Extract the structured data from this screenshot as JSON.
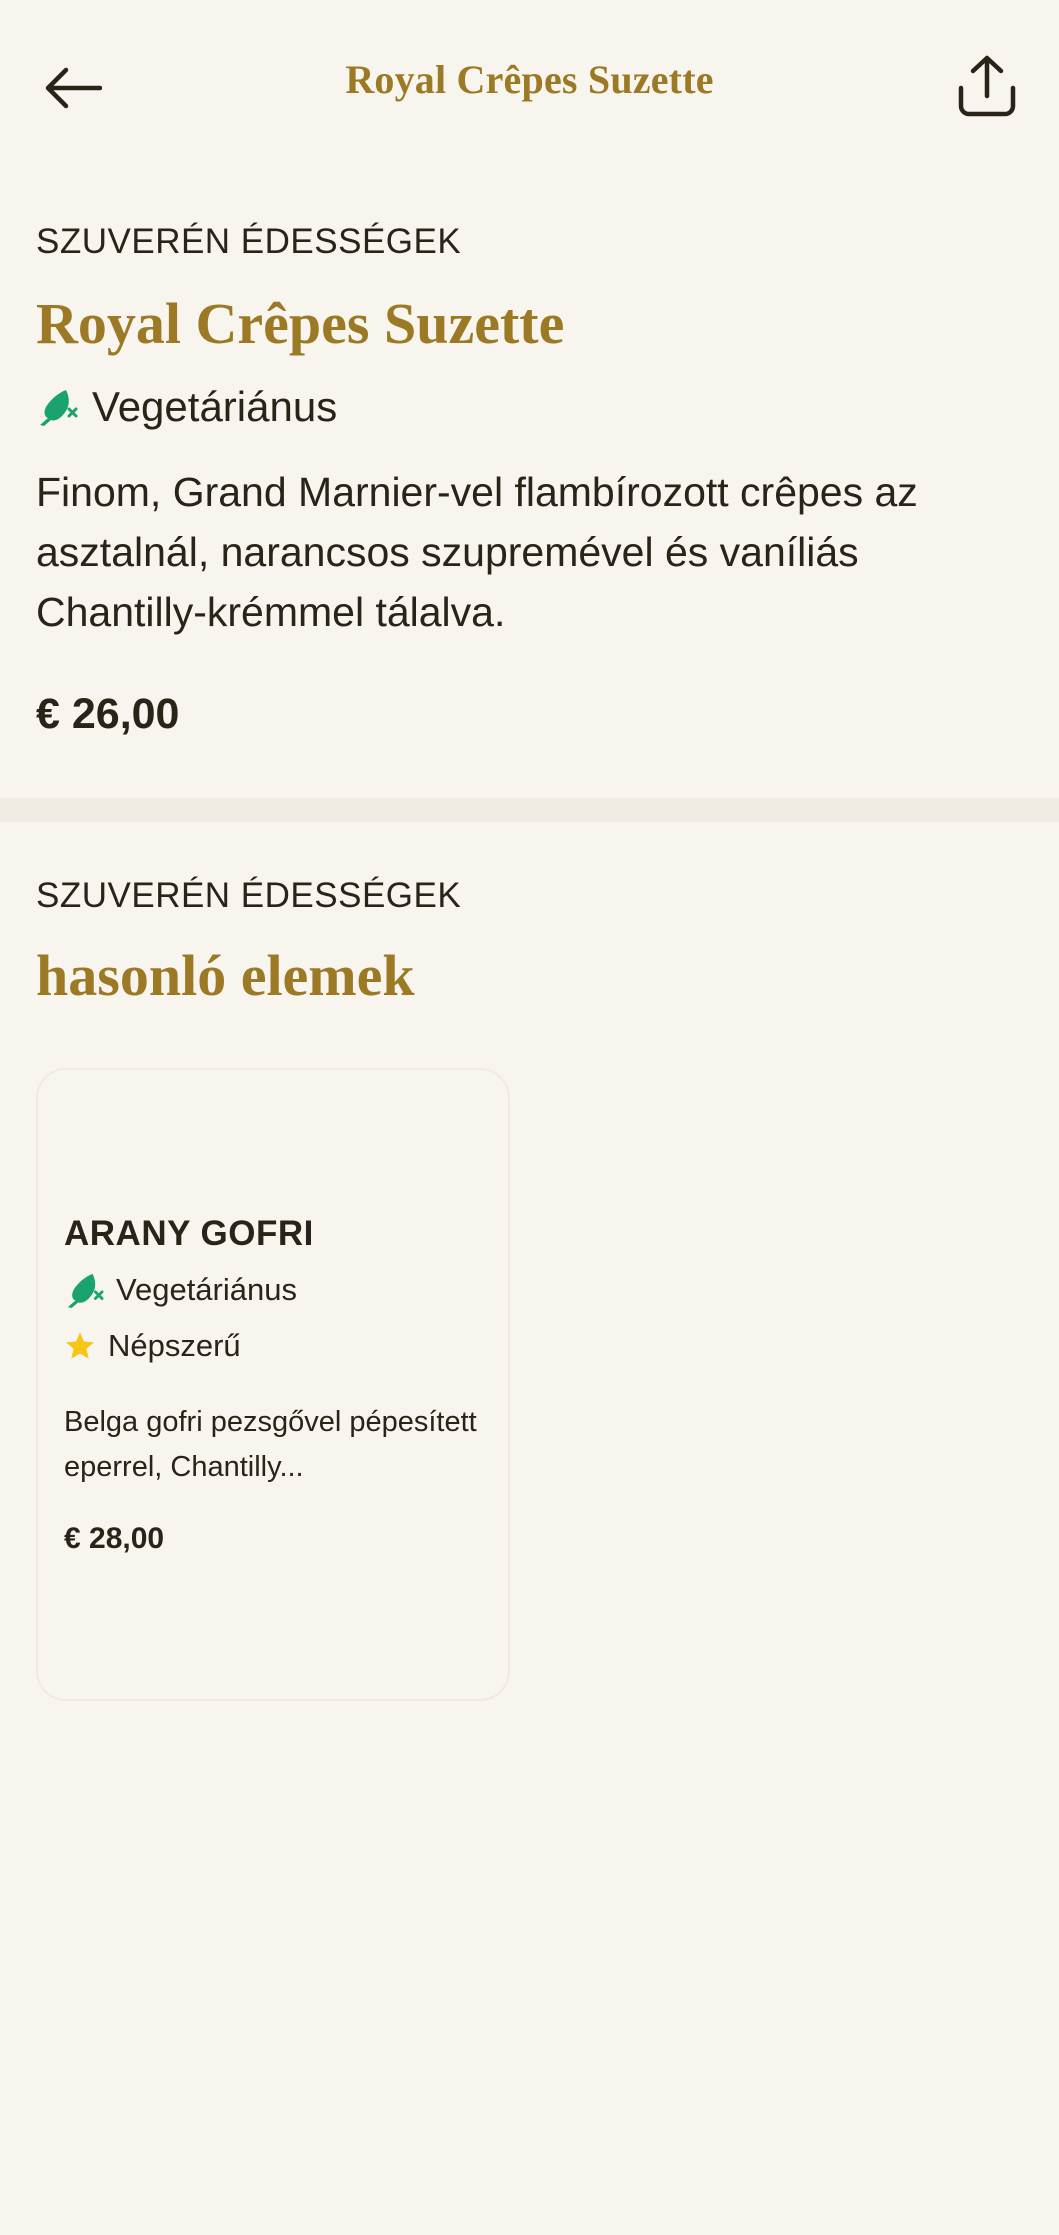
{
  "header": {
    "title": "Royal Crêpes Suzette",
    "back_icon": "arrow-left-icon",
    "share_icon": "share-icon"
  },
  "item": {
    "category": "SZUVERÉN ÉDESSÉGEK",
    "title": "Royal Crêpes Suzette",
    "tag_vegetarian": "Vegetáriánus",
    "description": "Finom, Grand Marnier-vel flambírozott crêpes az asztalnál, narancsos szupremével és vaníliás Chantilly-krémmel tálalva.",
    "price": "€ 26,00"
  },
  "similar": {
    "category": "SZUVERÉN ÉDESSÉGEK",
    "heading": "hasonló elemek",
    "items": [
      {
        "title": "ARANY GOFRI",
        "tag_vegetarian": "Vegetáriánus",
        "tag_popular": "Népszerű",
        "description": "Belga gofri pezsgővel pépesített eperrel, Chantilly...",
        "price": "€ 28,00"
      }
    ]
  },
  "colors": {
    "background": "#f8f5ef",
    "accent_gold": "#9c7a25",
    "text": "#2a2418",
    "veg_green": "#1aa36f",
    "star_yellow": "#f5c518",
    "divider": "#f0ece3"
  }
}
